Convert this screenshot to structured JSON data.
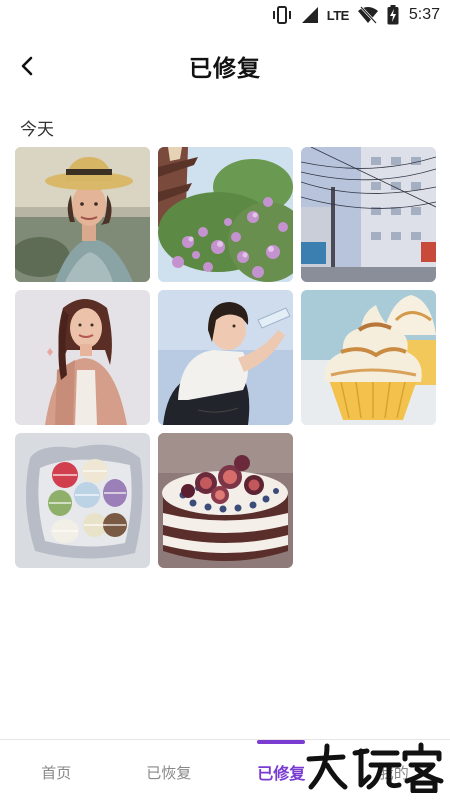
{
  "status_bar": {
    "network": "LTE",
    "time": "5:37",
    "icons": [
      "vibrate-icon",
      "signal-icon",
      "wifi-off-icon",
      "battery-charging-icon"
    ]
  },
  "header": {
    "title": "已修复",
    "back_icon": "chevron-left-icon"
  },
  "section": {
    "label": "今天"
  },
  "photos": [
    {
      "subject": "woman-in-straw-hat"
    },
    {
      "subject": "pink-blossoms-with-pagoda"
    },
    {
      "subject": "city-street-with-wires"
    },
    {
      "subject": "woman-in-pink-coat"
    },
    {
      "subject": "girl-drinking-water"
    },
    {
      "subject": "lemon-meringue-cupcake"
    },
    {
      "subject": "macarons-in-paper"
    },
    {
      "subject": "fig-layer-cake"
    }
  ],
  "tabbar": {
    "tabs": [
      {
        "label": "首页",
        "active": false
      },
      {
        "label": "已恢复",
        "active": false
      },
      {
        "label": "已修复",
        "active": true
      },
      {
        "label": "我的",
        "active": false
      }
    ]
  },
  "watermark": {
    "text": "大玩客"
  },
  "colors": {
    "accent": "#7a3cd0",
    "inactive_tab": "#888888",
    "divider": "#e6e6e6"
  }
}
